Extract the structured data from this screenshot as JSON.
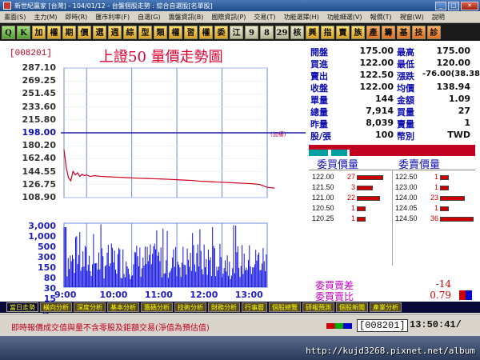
{
  "window": {
    "title": "新世紀贏家 [台灣] - 104/01/12 - 台盤個股走勢 : 綜合自選股[名單股]"
  },
  "menu": [
    "畫面(S)",
    "主力(M)",
    "即時(R)",
    "匯市利率(F)",
    "自選(G)",
    "籌盤資訊(B)",
    "國際資訊(P)",
    "交易(T)",
    "功能選擇(H)",
    "功能細選(V)",
    "報價(T)",
    "視窗(W)",
    "說明"
  ],
  "toolbar": [
    "Q",
    "K",
    "加",
    "權",
    "期",
    "價",
    "選",
    "週",
    "綜",
    "型",
    "類",
    "權",
    "習",
    "權",
    "委",
    "江",
    "9",
    "8",
    "29",
    "核",
    "興",
    "指",
    "賣",
    "族",
    "產",
    "籌",
    "基",
    "技",
    "診"
  ],
  "stock": {
    "code": "[008201]",
    "name": "上證50  量價走勢圖"
  },
  "price_axis": [
    "287.10",
    "269.25",
    "251.45",
    "233.60",
    "215.80",
    "198.00",
    "180.20",
    "162.40",
    "144.55",
    "126.75",
    "108.90"
  ],
  "volume_axis": [
    "3,000",
    "1,000",
    "500",
    "300",
    "150",
    "80",
    "30",
    "15",
    "張"
  ],
  "time_axis": [
    "9:00",
    "10:00",
    "11:00",
    "12:00",
    "13:00"
  ],
  "add_label": "(加權)",
  "quote": {
    "rows": [
      {
        "k1": "開盤",
        "v1": "175.00",
        "k2": "最高",
        "v2": "175.00"
      },
      {
        "k1": "買進",
        "v1": "122.00",
        "k2": "最低",
        "v2": "120.00"
      },
      {
        "k1": "賣出",
        "v1": "122.50",
        "k2": "漲跌",
        "v2": "-76.00(38.38)"
      },
      {
        "k1": "收盤",
        "v1": "122.00",
        "k2": "均價",
        "v2": "138.94"
      },
      {
        "k1": "單量",
        "v1": "144",
        "k2": "金額",
        "v2": "1.09"
      },
      {
        "k1": "總量",
        "v1": "7,914",
        "k2": "買量",
        "v2": "27"
      },
      {
        "k1": "昨量",
        "v1": "8,039",
        "k2": "賣量",
        "v2": "1"
      },
      {
        "k1": "股/張",
        "v1": "100",
        "k2": "幣別",
        "v2": "TWD"
      }
    ]
  },
  "book": {
    "bid_header": "委買價量",
    "ask_header": "委賣價量",
    "bids": [
      {
        "price": "122.00",
        "qty": "27",
        "bar": 0.75
      },
      {
        "price": "121.50",
        "qty": "3",
        "bar": 0.45
      },
      {
        "price": "121.00",
        "qty": "22",
        "bar": 0.65
      },
      {
        "price": "120.50",
        "qty": "1",
        "bar": 0.25
      },
      {
        "price": "120.25",
        "qty": "1",
        "bar": 0.25
      }
    ],
    "asks": [
      {
        "price": "122.50",
        "qty": "1",
        "bar": 0.25
      },
      {
        "price": "123.00",
        "qty": "1",
        "bar": 0.25
      },
      {
        "price": "124.00",
        "qty": "23",
        "bar": 0.7
      },
      {
        "price": "124.05",
        "qty": "1",
        "bar": 0.25
      },
      {
        "price": "124.50",
        "qty": "36",
        "bar": 0.95
      }
    ]
  },
  "summary": {
    "diff_label": "委買賣差",
    "diff_value": "-14",
    "ratio_label": "委買賣比",
    "ratio_value": "0.79"
  },
  "tabs": [
    "當日走勢",
    "橫向分析",
    "深度分析",
    "基本分析",
    "籌碼分析",
    "技術分析",
    "財務分析",
    "行事曆",
    "個股總覽",
    "研報預測",
    "個股新聞",
    "產業分析"
  ],
  "status": {
    "message": "即時報價成交值與量不含零股及鉅額交易(淨值為預估值)",
    "code": "[008201]",
    "time": "13:50:41/"
  },
  "watermark": "http://kujd3268.pixnet.net/album",
  "chart_data": {
    "type": "line",
    "ylim": [
      108.9,
      287.1
    ],
    "reference_price": 198.0,
    "x_minutes": [
      0,
      3,
      6,
      9,
      12,
      15,
      18,
      21,
      24,
      27,
      30,
      35,
      40,
      50,
      60,
      70,
      80,
      90,
      100,
      110,
      120,
      130,
      140,
      150,
      160,
      170,
      180,
      190,
      200,
      210,
      220,
      230,
      240,
      250,
      260,
      270,
      280
    ],
    "price": [
      175.0,
      150.0,
      136.0,
      132.0,
      145.0,
      140.0,
      143.0,
      138.0,
      141.0,
      139.0,
      140.0,
      138.0,
      139.0,
      138.0,
      137.5,
      137.0,
      136.5,
      136.0,
      135.5,
      135.2,
      134.8,
      134.5,
      134.0,
      133.5,
      133.0,
      132.5,
      131.5,
      131.0,
      130.5,
      130.0,
      129.5,
      129.0,
      128.5,
      128.0,
      127.0,
      123.0,
      122.0
    ],
    "colors": {
      "price_line": "#d00020",
      "reference": "#2020a0",
      "volume": "#1010e0",
      "grid": "#6a8ad8"
    }
  }
}
